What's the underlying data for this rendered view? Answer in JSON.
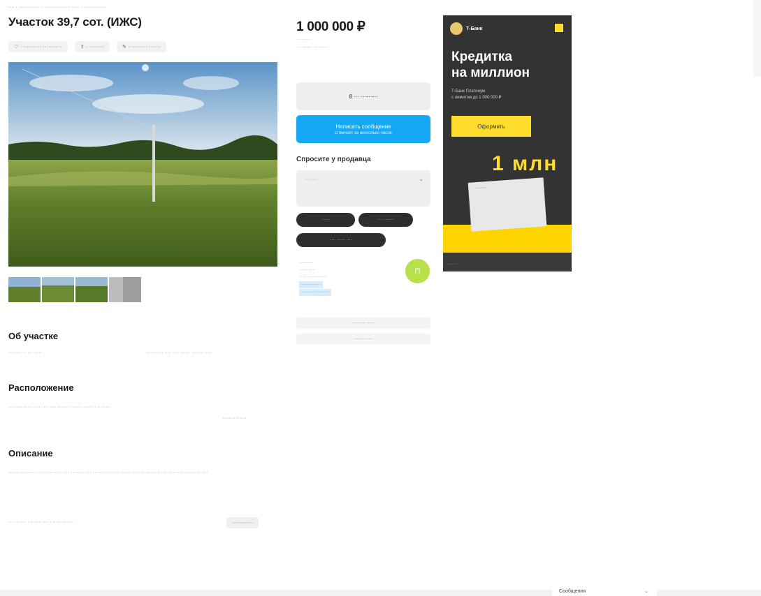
{
  "breadcrumbs": "··· · ··········· · ············ · ···· · ············",
  "listing": {
    "title": "Участок 39,7 сот. (ИЖС)",
    "actions": [
      "· ··········· ·· ·········",
      "· ·········",
      "· ·········· ·······"
    ],
    "thumb_count": 4
  },
  "sections": {
    "about": {
      "heading": "Об участке",
      "left": "········ ·· ··· ·····",
      "right": "··········· ···· ···· ······ ······· ·····"
    },
    "location": {
      "heading": "Расположение",
      "address": "···········  ··· ···· ···· ···· ······· ······· ········ ········",
      "map_link": "········ ······"
    },
    "description": {
      "heading": "Описание",
      "text": "······ ·········· ···· ·········· ···· ········ ···· ··········· ···· ······ ···· ··· ········· ··········· ········· ·······",
      "footer_left": "·· ········ · ··········· · ····· ·······",
      "footer_btn": "·············"
    }
  },
  "sidebar": {
    "price": "1 000 000 ₽",
    "price_sub": "·· ······ ·",
    "price_link": "··· ······· ······· ···",
    "phone_btn": "8 ··· ···-··-··",
    "msg_btn": "Написать сообщение",
    "msg_btn_sub": "Отвечает за несколько часов",
    "ask_heading": "Спросите у продавца",
    "ask_placeholder": "········",
    "chips": [
      "·····",
      "···· ·······",
      "···· ······ ····"
    ],
    "seller_name": "··········",
    "seller_type": "······ ·····",
    "seller_since": "·· ····· · ····· ····",
    "seller_tag1": "···· ·········",
    "seller_tag2": "············ ·······",
    "avatar_letter": "П",
    "link1": "········· ·····",
    "link2": "········ ·····"
  },
  "ad": {
    "brand": "Т-Банк",
    "headline1": "Кредитка",
    "headline2": "на миллион",
    "small1": "Т-Банк Платинум",
    "small2": "с лимитом до 1 000 000 ₽",
    "cta": "Оформить",
    "big": "1 млн",
    "card_label": "··· ·······",
    "legal": "····· ·····"
  },
  "bottom": {
    "msg_widget": "Сообщения"
  }
}
